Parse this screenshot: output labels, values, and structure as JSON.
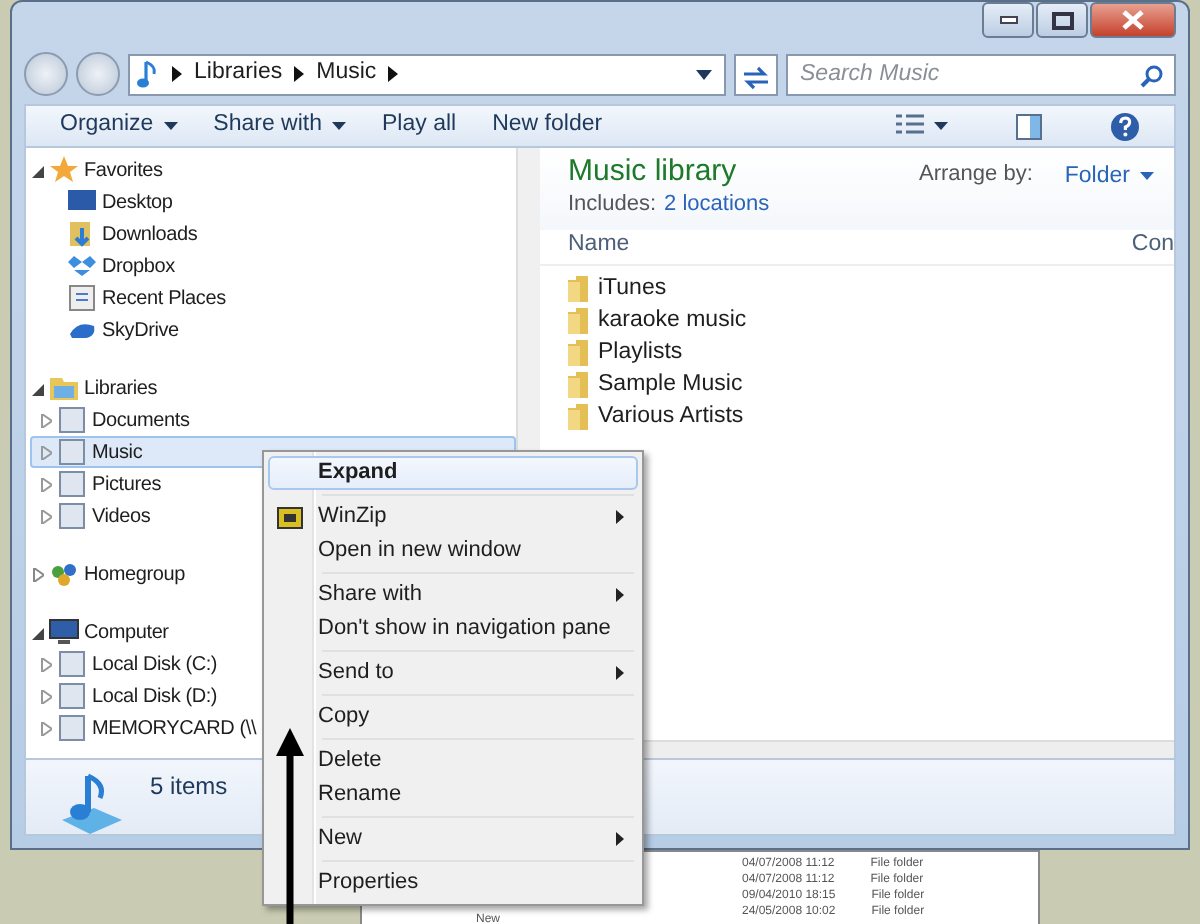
{
  "address": {
    "crumbs": [
      "Libraries",
      "Music"
    ]
  },
  "search": {
    "placeholder": "Search Music"
  },
  "toolbar": [
    {
      "label": "Organize",
      "has_menu": true
    },
    {
      "label": "Share with",
      "has_menu": true
    },
    {
      "label": "Play all",
      "has_menu": false
    },
    {
      "label": "New folder",
      "has_menu": false
    }
  ],
  "nav": [
    {
      "label": "Favorites",
      "expanded": true,
      "selected": false,
      "children": [
        {
          "label": "Desktop",
          "selected": false
        },
        {
          "label": "Downloads",
          "selected": false
        },
        {
          "label": "Dropbox",
          "selected": false
        },
        {
          "label": "Recent Places",
          "selected": false
        },
        {
          "label": "SkyDrive",
          "selected": false
        }
      ]
    },
    {
      "label": "Libraries",
      "expanded": true,
      "selected": false,
      "children": [
        {
          "label": "Documents",
          "selected": false,
          "expanded": false
        },
        {
          "label": "Music",
          "selected": true,
          "expanded": false
        },
        {
          "label": "Pictures",
          "selected": false,
          "expanded": false
        },
        {
          "label": "Videos",
          "selected": false,
          "expanded": false
        }
      ]
    },
    {
      "label": "Homegroup",
      "expanded": false,
      "selected": false
    },
    {
      "label": "Computer",
      "expanded": true,
      "selected": false,
      "children": [
        {
          "label": "Local Disk (C:)",
          "selected": false,
          "expanded": false
        },
        {
          "label": "Local Disk (D:)",
          "selected": false,
          "expanded": false
        },
        {
          "label": "MEMORYCARD (\\\\",
          "selected": false,
          "expanded": false
        }
      ]
    }
  ],
  "library": {
    "title": "Music library",
    "includes_label": "Includes:",
    "includes_link": "2 locations",
    "arrange_label": "Arrange by:",
    "arrange_value": "Folder"
  },
  "columns": [
    "Name",
    "Con"
  ],
  "files": [
    "iTunes",
    "karaoke music",
    "Playlists",
    "Sample Music",
    "Various Artists"
  ],
  "status_bar": {
    "count": "5 items"
  },
  "context_menu": [
    {
      "kind": "item",
      "label": "Expand",
      "bold": true,
      "highlighted": true,
      "submenu": false
    },
    {
      "kind": "separator"
    },
    {
      "kind": "item",
      "label": "WinZip",
      "bold": false,
      "highlighted": false,
      "submenu": true,
      "icon": true
    },
    {
      "kind": "item",
      "label": "Open in new window",
      "bold": false,
      "highlighted": false,
      "submenu": false
    },
    {
      "kind": "separator"
    },
    {
      "kind": "item",
      "label": "Share with",
      "bold": false,
      "highlighted": false,
      "submenu": true
    },
    {
      "kind": "item",
      "label": "Don't show in navigation pane",
      "bold": false,
      "highlighted": false,
      "submenu": false
    },
    {
      "kind": "separator"
    },
    {
      "kind": "item",
      "label": "Send to",
      "bold": false,
      "highlighted": false,
      "submenu": true
    },
    {
      "kind": "separator"
    },
    {
      "kind": "item",
      "label": "Copy",
      "bold": false,
      "highlighted": false,
      "submenu": false
    },
    {
      "kind": "separator"
    },
    {
      "kind": "item",
      "label": "Delete",
      "bold": false,
      "highlighted": false,
      "submenu": false
    },
    {
      "kind": "item",
      "label": "Rename",
      "bold": false,
      "highlighted": false,
      "submenu": false
    },
    {
      "kind": "separator"
    },
    {
      "kind": "item",
      "label": "New",
      "bold": false,
      "highlighted": false,
      "submenu": true
    },
    {
      "kind": "separator"
    },
    {
      "kind": "item",
      "label": "Properties",
      "bold": false,
      "highlighted": false,
      "submenu": false
    }
  ],
  "background_window": {
    "rows": [
      {
        "date": "04/07/2008 11:12",
        "type": "File folder"
      },
      {
        "date": "04/07/2008 11:12",
        "type": "File folder"
      },
      {
        "date": "09/04/2010 18:15",
        "type": "File folder"
      },
      {
        "date": "24/05/2008 10:02",
        "type": "File folder"
      }
    ],
    "footer": "New"
  }
}
